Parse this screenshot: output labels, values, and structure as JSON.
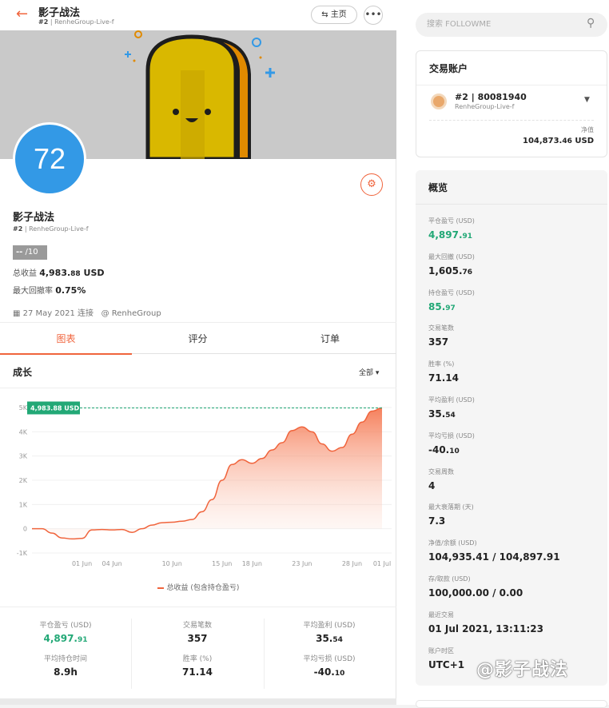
{
  "header": {
    "back_icon": "arrow-left-icon",
    "title": "影子战法",
    "rank": "#2",
    "server": "RenheGroup-Live-f",
    "home_label": "主页",
    "more_label": "•••"
  },
  "profile": {
    "avatar_text": "72",
    "name": "影子战法",
    "rank": "#2",
    "server": "RenheGroup-Live-f",
    "score": "--",
    "score_max": "/10",
    "total_profit_label": "总收益",
    "total_profit_main": "4,983.",
    "total_profit_dec": "88",
    "total_profit_unit": "USD",
    "max_dd_label": "最大回撤率",
    "max_dd_value": "0.75%",
    "connected_date": "27 May 2021 连接",
    "broker": "@ RenheGroup"
  },
  "tabs": [
    {
      "label": "图表"
    },
    {
      "label": "评分"
    },
    {
      "label": "订单"
    }
  ],
  "chart_header": {
    "title": "成长",
    "filter": "全部"
  },
  "chart_data": {
    "type": "area",
    "title": "",
    "xlabel": "",
    "ylabel": "",
    "x_ticks": [
      "01 Jun",
      "04 Jun",
      "10 Jun",
      "15 Jun",
      "18 Jun",
      "23 Jun",
      "28 Jun",
      "01 Jul"
    ],
    "y_ticks": [
      "5K",
      "4K",
      "3K",
      "2K",
      "1K",
      "0",
      "-1K"
    ],
    "ylim": [
      -1000,
      5000
    ],
    "current_label": "4,983.88 USD",
    "series": [
      {
        "name": "总收益 (包含持仓盈亏)",
        "color": "#f0643c",
        "points": [
          {
            "x": "27 May",
            "y": 0
          },
          {
            "x": "28 May",
            "y": 0
          },
          {
            "x": "29 May",
            "y": -180
          },
          {
            "x": "30 May",
            "y": -380
          },
          {
            "x": "31 May",
            "y": -420
          },
          {
            "x": "01 Jun",
            "y": -400
          },
          {
            "x": "02 Jun",
            "y": -50
          },
          {
            "x": "03 Jun",
            "y": -30
          },
          {
            "x": "04 Jun",
            "y": -50
          },
          {
            "x": "05 Jun",
            "y": -30
          },
          {
            "x": "06 Jun",
            "y": -150
          },
          {
            "x": "07 Jun",
            "y": 0
          },
          {
            "x": "08 Jun",
            "y": 150
          },
          {
            "x": "09 Jun",
            "y": 250
          },
          {
            "x": "10 Jun",
            "y": 270
          },
          {
            "x": "11 Jun",
            "y": 310
          },
          {
            "x": "12 Jun",
            "y": 380
          },
          {
            "x": "13 Jun",
            "y": 700
          },
          {
            "x": "14 Jun",
            "y": 1200
          },
          {
            "x": "15 Jun",
            "y": 2000
          },
          {
            "x": "16 Jun",
            "y": 2650
          },
          {
            "x": "17 Jun",
            "y": 2850
          },
          {
            "x": "18 Jun",
            "y": 2700
          },
          {
            "x": "19 Jun",
            "y": 2900
          },
          {
            "x": "20 Jun",
            "y": 3250
          },
          {
            "x": "21 Jun",
            "y": 3550
          },
          {
            "x": "22 Jun",
            "y": 4050
          },
          {
            "x": "23 Jun",
            "y": 4200
          },
          {
            "x": "24 Jun",
            "y": 4000
          },
          {
            "x": "25 Jun",
            "y": 3500
          },
          {
            "x": "26 Jun",
            "y": 3200
          },
          {
            "x": "27 Jun",
            "y": 3350
          },
          {
            "x": "28 Jun",
            "y": 3900
          },
          {
            "x": "29 Jun",
            "y": 4400
          },
          {
            "x": "30 Jun",
            "y": 4850
          },
          {
            "x": "01 Jul",
            "y": 4983.88
          }
        ]
      }
    ],
    "grid": true,
    "legend": "bottom-center"
  },
  "stats": [
    {
      "label": "平仓盈亏 (USD)",
      "main": "4,897.",
      "dec": "91",
      "green": true
    },
    {
      "label": "交易笔数",
      "main": "357",
      "dec": "",
      "green": false
    },
    {
      "label": "平均盈利 (USD)",
      "main": "35.",
      "dec": "54",
      "green": false
    },
    {
      "label": "平均持仓时间",
      "main": "8.9h",
      "dec": "",
      "green": false
    },
    {
      "label": "胜率 (%)",
      "main": "71.14",
      "dec": "",
      "green": false
    },
    {
      "label": "平均亏损 (USD)",
      "main": "-40.",
      "dec": "10",
      "green": false
    }
  ],
  "search": {
    "placeholder": "搜索 FOLLOWME",
    "icon": "search-icon"
  },
  "account_card": {
    "title": "交易账户",
    "rank": "#2",
    "number": "80081940",
    "server": "RenheGroup-Live-f",
    "net_label": "净值",
    "net_main": "104,873.",
    "net_dec": "46",
    "net_unit": "USD"
  },
  "overview": {
    "title": "概览",
    "items": [
      {
        "label": "平仓盈亏 (USD)",
        "main": "4,897.",
        "dec": "91",
        "green": true
      },
      {
        "label": "最大回撤 (USD)",
        "main": "1,605.",
        "dec": "76",
        "green": false
      },
      {
        "label": "持仓盈亏 (USD)",
        "main": "85.",
        "dec": "97",
        "green": true
      },
      {
        "label": "交易笔数",
        "main": "357",
        "dec": "",
        "green": false
      },
      {
        "label": "胜率 (%)",
        "main": "71.14",
        "dec": "",
        "green": false
      },
      {
        "label": "平均盈利 (USD)",
        "main": "35.",
        "dec": "54",
        "green": false
      },
      {
        "label": "平均亏损 (USD)",
        "main": "-40.",
        "dec": "10",
        "green": false
      },
      {
        "label": "交易周数",
        "main": "4",
        "dec": "",
        "green": false
      },
      {
        "label": "最大衰落期 (天)",
        "main": "7.3",
        "dec": "",
        "green": false
      },
      {
        "label": "净值/余额 (USD)",
        "main": "104,935.41 / 104,897.91",
        "dec": "",
        "green": false
      },
      {
        "label": "存/取款 (USD)",
        "main": "100,000.00 / 0.00",
        "dec": "",
        "green": false
      },
      {
        "label": "最近交易",
        "main": "01 Jul 2021, 13:11:23",
        "dec": "",
        "green": false
      },
      {
        "label": "账户时区",
        "main": "UTC+1",
        "dec": "",
        "green": false
      }
    ]
  },
  "watermark": "@影子战法"
}
